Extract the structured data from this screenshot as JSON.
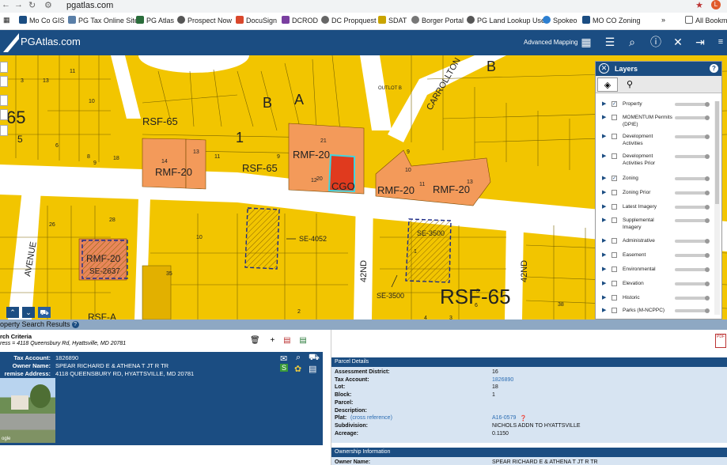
{
  "browser": {
    "url": "pgatlas.com",
    "bookmarks": [
      "Mo Co GIS",
      "PG Tax Online Site",
      "PG Atlas",
      "Prospect Now",
      "DocuSign",
      "DCROD",
      "DC Propquest",
      "SDAT",
      "Borger Portal",
      "PG Land Lookup Use",
      "Spokeo",
      "MO CO Zoning"
    ],
    "all_bookmarks": "All Bookm",
    "more": "»"
  },
  "app": {
    "logo": "PGAtlas.com",
    "advanced_mapping": "Advanced Mapping"
  },
  "map": {
    "zone_labels": [
      "RSF-65",
      "RMF-20",
      "RSF-65",
      "RMF-20",
      "CGO",
      "RMF-20",
      "RMF-20",
      "RMF-20",
      "RSF-65",
      "RSF-A",
      "65"
    ],
    "overlay_labels": [
      "SE-4052",
      "SE-3500",
      "SE-3500",
      "SE-2637"
    ],
    "street_labels": [
      "CARROLLTON",
      "42ND",
      "42ND",
      "AVENUE",
      "OUTLOT B"
    ],
    "block_labels": [
      "B",
      "A",
      "1",
      "B"
    ],
    "lot_numbers": [
      "3",
      "13",
      "11",
      "10",
      "14",
      "13",
      "11",
      "9",
      "21",
      "20",
      "12",
      "9",
      "10",
      "11",
      "13",
      "6",
      "8",
      "9",
      "18",
      "10",
      "26",
      "28",
      "35",
      "2",
      "3",
      "38",
      "5",
      "1",
      "3",
      "4",
      "6"
    ]
  },
  "layers": {
    "title": "Layers",
    "help": "?",
    "items": [
      {
        "label": "Property",
        "checked": true
      },
      {
        "label": "MOMENTUM Permits (DPIE)",
        "checked": false
      },
      {
        "label": "Development Activities",
        "checked": false
      },
      {
        "label": "Development Activities Prior",
        "checked": false
      },
      {
        "label": "Zoning",
        "checked": true
      },
      {
        "label": "Zoning Prior",
        "checked": false
      },
      {
        "label": "Latest Imagery",
        "checked": false
      },
      {
        "label": "Supplemental Imagery",
        "checked": false
      },
      {
        "label": "Administrative",
        "checked": false
      },
      {
        "label": "Easement",
        "checked": false
      },
      {
        "label": "Environmental",
        "checked": false
      },
      {
        "label": "Elevation",
        "checked": false
      },
      {
        "label": "Historic",
        "checked": false
      },
      {
        "label": "Parks (M-NCPPC)",
        "checked": false
      }
    ]
  },
  "results": {
    "title": "operty Search Results",
    "criteria_title": "rch Criteria",
    "criteria_value": "ress = 4118 Queensbury Rd, Hyattsville, MD 20781",
    "tax_account_label": "Tax Account:",
    "tax_account": "1826890",
    "owner_label": "Owner Name:",
    "owner": "SPEAR RICHARD E & ATHENA T JT R TR",
    "premise_label": "remise Address:",
    "premise": "4118 QUEENSBURY RD, HYATTSVILLE, MD 20781",
    "photo_caption": "ogle"
  },
  "parcel": {
    "section_title": "Parcel Details",
    "rows": [
      {
        "label": "Assessment District:",
        "value": "16",
        "link": false
      },
      {
        "label": "Tax Account:",
        "value": "1826890",
        "link": true
      },
      {
        "label": "Lot:",
        "value": "18",
        "link": false
      },
      {
        "label": "Block:",
        "value": "1",
        "link": false
      },
      {
        "label": "Parcel:",
        "value": "",
        "link": false
      },
      {
        "label": "Description:",
        "value": "",
        "link": false
      },
      {
        "label": "Plat:",
        "value": "A16-0579",
        "link": true
      },
      {
        "label": "Subdivision:",
        "value": "NICHOLS ADDN TO HYATTSVILLE",
        "link": false
      },
      {
        "label": "Acreage:",
        "value": "0.1150",
        "link": false
      }
    ],
    "plat_note": "(cross reference)",
    "ownership_title": "Ownership Information",
    "owner_label": "Owner Name:",
    "owner_value": "SPEAR RICHARD E & ATHENA T JT R TR"
  }
}
